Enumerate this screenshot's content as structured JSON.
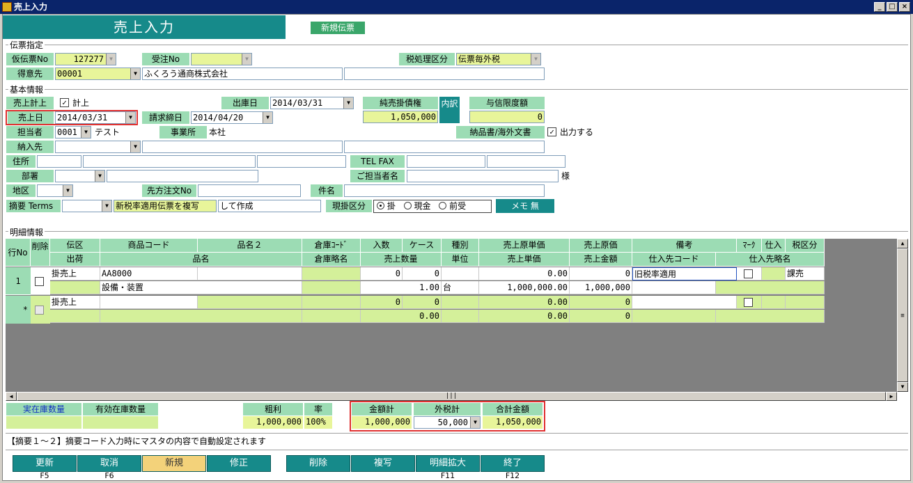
{
  "window": {
    "title": "売上入力"
  },
  "header": {
    "title": "売上入力",
    "new_slip": "新規伝票"
  },
  "slip": {
    "section": "伝票指定",
    "temp_no_label": "仮伝票No",
    "temp_no": "127277",
    "order_no_label": "受注No",
    "order_no": "",
    "tax_label": "税処理区分",
    "tax_value": "伝票毎外税",
    "customer_label": "得意先",
    "customer_code": "00001",
    "customer_name": "ふくろう通商株式会社",
    "customer_extra": ""
  },
  "basic": {
    "section": "基本情報",
    "sales_post_label": "売上計上",
    "sales_post_check": "計上",
    "sales_post_checked": true,
    "ship_date_label": "出庫日",
    "ship_date": "2014/03/31",
    "net_ar_label": "純売掛債権",
    "net_ar": "1,050,000",
    "breakdown": "内訳",
    "credit_label": "与信限度額",
    "credit": "0",
    "sales_date_label": "売上日",
    "sales_date": "2014/03/31",
    "bill_close_label": "請求締日",
    "bill_close": "2014/04/20",
    "staff_label": "担当者",
    "staff_code": "0001",
    "staff_name": "テスト",
    "office_label": "事業所",
    "office": "本社",
    "delivery_doc_label": "納品書/海外文書",
    "output_check": "出力する",
    "output_checked": true,
    "delivery_label": "納入先",
    "delivery_code": "",
    "delivery_name": "",
    "delivery_extra": "",
    "address_label": "住所",
    "address1": "",
    "address2": "",
    "address3": "",
    "tel_label": "TEL FAX",
    "tel": "",
    "fax": "",
    "dept_label": "部署",
    "dept_code": "",
    "dept_name": "",
    "contact_label": "ご担当者名",
    "contact": "",
    "honorific": "様",
    "area_label": "地区",
    "area": "",
    "customer_order_label": "先方注文No",
    "customer_order": "",
    "subject_label": "件名",
    "subject": "",
    "summary_label": "摘要 Terms",
    "summary_code": "",
    "summary_text1": "新税率適用伝票を複写",
    "summary_text2": "して作成",
    "payment_label": "現掛区分",
    "pay_credit": "掛",
    "pay_cash": "現金",
    "pay_advance": "前受",
    "memo_button": "メモ 無"
  },
  "detail": {
    "section": "明細情報",
    "headers_top": [
      "行No",
      "削除",
      "伝区",
      "商品コード",
      "品名２",
      "倉庫ｺｰﾄﾞ",
      "入数",
      "ケース",
      "種別",
      "売上原単価",
      "売上原価",
      "備考",
      "ﾏｰｸ",
      "仕入",
      "税区分"
    ],
    "headers_bottom": [
      "出荷",
      "品名",
      "倉庫略名",
      "売上数量",
      "単位",
      "売上単価",
      "売上金額",
      "仕入先コード",
      "仕入先略名"
    ],
    "row1": {
      "no": "1",
      "type": "掛売上",
      "code": "AA8000",
      "name2": "",
      "wh_code": "",
      "qty_per": "0",
      "cases": "0",
      "kind": "",
      "cost_unit": "0.00",
      "cost": "0",
      "remarks": "旧税率適用",
      "tax": "課売",
      "ship": "",
      "name": "設備・装置",
      "wh_name": "",
      "qty": "1.00",
      "unit": "台",
      "price": "1,000,000.00",
      "amount": "1,000,000",
      "supplier_code": "",
      "supplier_name": ""
    },
    "row2": {
      "no": "*",
      "type": "掛売上",
      "code": "",
      "qty_per": "0",
      "cases": "0",
      "cost_unit": "0.00",
      "cost": "0",
      "qty": "0.00",
      "price": "0.00",
      "amount": "0"
    }
  },
  "footer": {
    "actual_stock_label": "実在庫数量",
    "effective_stock_label": "有効在庫数量",
    "gross_label": "粗利",
    "gross": "1,000,000",
    "rate_label": "率",
    "rate": "100%",
    "amount_label": "金額計",
    "amount": "1,000,000",
    "tax_label": "外税計",
    "tax": "50,000",
    "total_label": "合計金額",
    "total": "1,050,000",
    "message": "【摘要１～２】摘要コード入力時にマスタの内容で自動設定されます"
  },
  "buttons": [
    {
      "label": "更新",
      "key": "F5"
    },
    {
      "label": "取消",
      "key": "F6"
    },
    {
      "label": "新規",
      "key": ""
    },
    {
      "label": "修正",
      "key": ""
    },
    {
      "label": "削除",
      "key": ""
    },
    {
      "label": "複写",
      "key": ""
    },
    {
      "label": "明細拡大",
      "key": "F11"
    },
    {
      "label": "終了",
      "key": "F12"
    }
  ],
  "colors": {
    "accent": "#168a8a",
    "label_bg": "#9cdcb4",
    "input_yellow": "#e8f59a",
    "highlight": "#e03030"
  }
}
